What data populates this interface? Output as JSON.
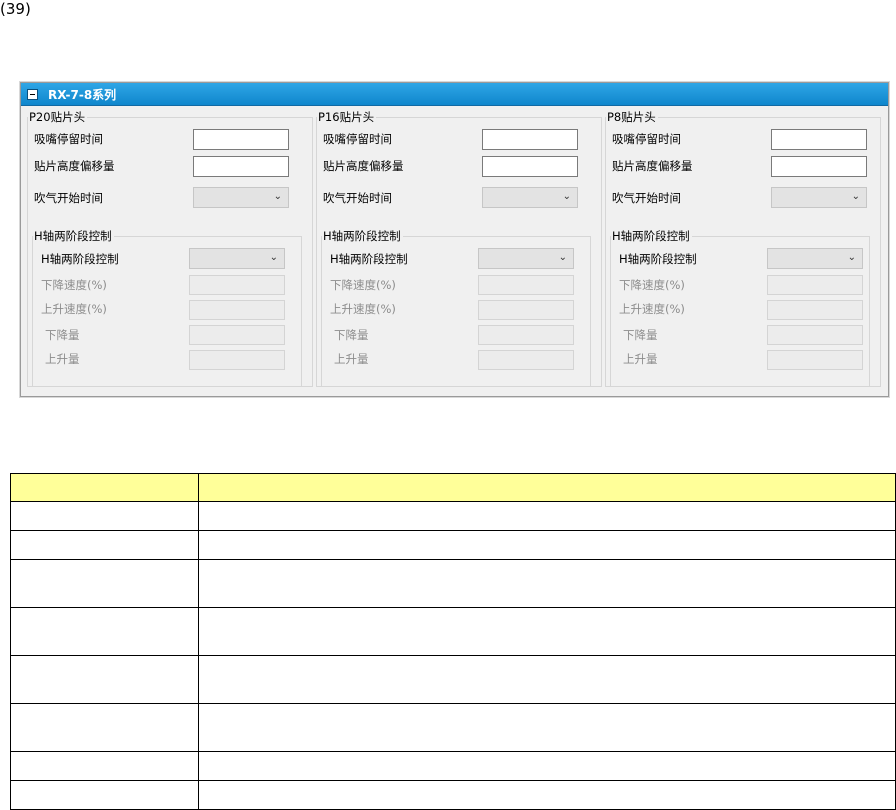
{
  "figure_label": "(39)",
  "panel": {
    "title": "RX-7-8系列",
    "heads": [
      {
        "title": "P20贴片头",
        "fields": {
          "nozzle_dwell": "吸嘴停留时间",
          "height_offset": "贴片高度偏移量",
          "blow_start": "吹气开始时间"
        },
        "nozzle_dwell_value": "",
        "height_offset_value": "",
        "h_axis_group": "H轴两阶段控制",
        "h_axis_control": "H轴两阶段控制",
        "descend_speed": "下降速度(%)",
        "ascend_speed": "上升速度(%)",
        "descend_amount": "下降量",
        "ascend_amount": "上升量"
      },
      {
        "title": "P16贴片头",
        "fields": {
          "nozzle_dwell": "吸嘴停留时间",
          "height_offset": "贴片高度偏移量",
          "blow_start": "吹气开始时间"
        },
        "nozzle_dwell_value": "",
        "height_offset_value": "",
        "h_axis_group": "H轴两阶段控制",
        "h_axis_control": "H轴两阶段控制",
        "descend_speed": "下降速度(%)",
        "ascend_speed": "上升速度(%)",
        "descend_amount": "下降量",
        "ascend_amount": "上升量"
      },
      {
        "title": "P8贴片头",
        "fields": {
          "nozzle_dwell": "吸嘴停留时间",
          "height_offset": "贴片高度偏移量",
          "blow_start": "吹气开始时间"
        },
        "nozzle_dwell_value": "",
        "height_offset_value": "",
        "h_axis_group": "H轴两阶段控制",
        "h_axis_control": "H轴两阶段控制",
        "descend_speed": "下降速度(%)",
        "ascend_speed": "上升速度(%)",
        "descend_amount": "下降量",
        "ascend_amount": "上升量"
      }
    ]
  },
  "table": {
    "headers": [
      "",
      ""
    ],
    "rows": [
      {
        "name": "",
        "desc": "",
        "tall": false
      },
      {
        "name": "",
        "desc": "",
        "tall": false
      },
      {
        "name": "",
        "desc": "",
        "tall": true
      },
      {
        "name": "",
        "desc": "",
        "tall": true
      },
      {
        "name": "",
        "desc": "",
        "tall": true
      },
      {
        "name": "",
        "desc": "",
        "tall": true
      },
      {
        "name": "",
        "desc": "",
        "tall": false
      },
      {
        "name": "",
        "desc": "",
        "tall": false
      }
    ]
  },
  "colors": {
    "title_bar": "#1496d8",
    "table_header": "#ffff99",
    "panel_bg": "#f0f0f0"
  }
}
